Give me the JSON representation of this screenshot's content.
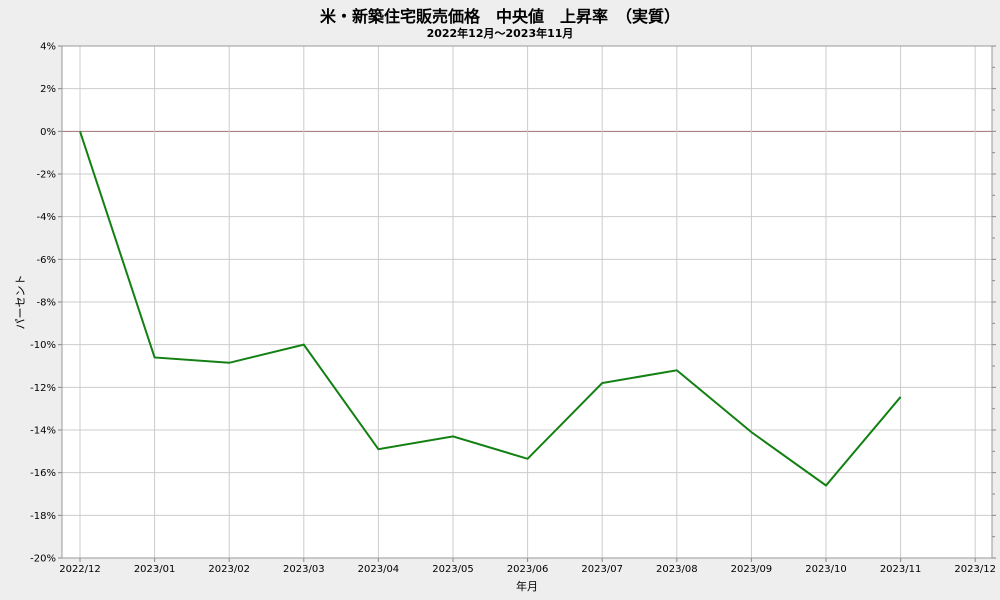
{
  "header": {
    "title": "米・新築住宅販売価格　中央値　上昇率　（実質）",
    "subtitle": "2022年12月～2023年11月"
  },
  "colors": {
    "background": "#eeeeee",
    "plot_background": "#ffffff",
    "grid": "#cccccc",
    "zero_line": "#a07070",
    "series": "#128012"
  },
  "chart_data": {
    "type": "line",
    "xlabel": "年月",
    "ylabel": "パーセント",
    "categories": [
      "2022/12",
      "2023/01",
      "2023/02",
      "2023/03",
      "2023/04",
      "2023/05",
      "2023/06",
      "2023/07",
      "2023/08",
      "2023/09",
      "2023/10",
      "2023/11",
      "2023/12"
    ],
    "ylim": [
      -20,
      4
    ],
    "yticks": [
      "4%",
      "2%",
      "0%",
      "-2%",
      "-4%",
      "-6%",
      "-8%",
      "-10%",
      "-12%",
      "-14%",
      "-16%",
      "-18%",
      "-20%"
    ],
    "ytick_values": [
      4,
      2,
      0,
      -2,
      -4,
      -6,
      -8,
      -10,
      -12,
      -14,
      -16,
      -18,
      -20
    ],
    "grid": true,
    "legend": "none",
    "series": [
      {
        "values": [
          0.0,
          -10.6,
          -10.85,
          -10.0,
          -14.9,
          -14.3,
          -15.35,
          -11.8,
          -11.2,
          -14.1,
          -16.6,
          -12.45,
          null
        ]
      }
    ]
  }
}
